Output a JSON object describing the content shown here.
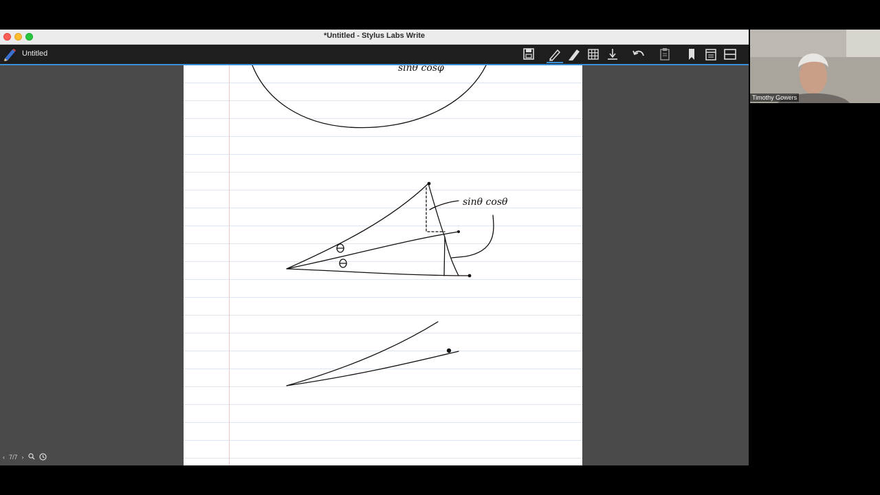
{
  "window": {
    "title": "*Untitled - Stylus Labs Write",
    "doc_title": "Untitled"
  },
  "toolbar": {
    "buttons": [
      "save-icon",
      "pen-icon",
      "highlighter-icon",
      "grid-icon",
      "insert-space-icon",
      "undo-icon",
      "clipboard-icon",
      "bookmark-icon",
      "pages-icon",
      "layout-icon"
    ],
    "active_tool": "pen",
    "accent_color": "#3d8fd6"
  },
  "canvas": {
    "handwriting": [
      "sinθ cosφ",
      "sinθ cosθ",
      "θ",
      "θ"
    ]
  },
  "page_nav": {
    "prev": "‹",
    "page": "7/7",
    "next": "›"
  },
  "webcam": {
    "name": "Timothy Gowers"
  }
}
